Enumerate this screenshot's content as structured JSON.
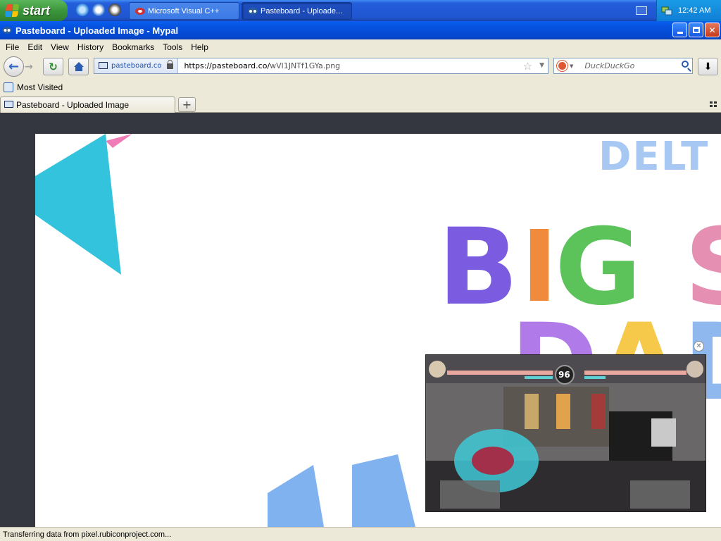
{
  "taskbar": {
    "start_label": "start",
    "tasks": [
      {
        "label": "Microsoft Visual C++",
        "icon": "visual-cpp-icon"
      },
      {
        "label": "Pasteboard - Uploade...",
        "icon": "mypal-icon"
      }
    ],
    "clock": "12:42 AM"
  },
  "window": {
    "title": "Pasteboard - Uploaded Image - Mypal",
    "controls": [
      "minimize",
      "maximize",
      "close"
    ]
  },
  "menu": [
    "File",
    "Edit",
    "View",
    "History",
    "Bookmarks",
    "Tools",
    "Help"
  ],
  "navigation": {
    "site_identity": "pasteboard.co",
    "url_prefix": "https://pasteboard.co/",
    "url_path": "wVl1JNTf1GYa.png",
    "search_placeholder": "DuckDuckGo"
  },
  "bookmarks": {
    "most_visited": "Most Visited"
  },
  "tabs": [
    {
      "title": "Pasteboard - Uploaded Image",
      "active": true
    }
  ],
  "content": {
    "image_text_delta": "DELT",
    "image_text_big": [
      "B",
      "I",
      "G",
      "S"
    ],
    "image_text_big_colors": [
      "#7b5ce0",
      "#f08a3c",
      "#5cc25a",
      "#e58fb3"
    ],
    "image_text_row2": [
      "D",
      "A",
      "D"
    ],
    "image_text_row2_colors": [
      "#b07be8",
      "#f6c94a",
      "#8fb8ef"
    ],
    "video_timer": "96"
  },
  "status_bar": "Transferring data from pixel.rubiconproject.com...",
  "colors": {
    "taskbar_blue": "#245edb",
    "start_green": "#3c963c",
    "title_blue": "#0653df",
    "chrome_beige": "#ece9d8",
    "page_dark": "#34373f"
  }
}
